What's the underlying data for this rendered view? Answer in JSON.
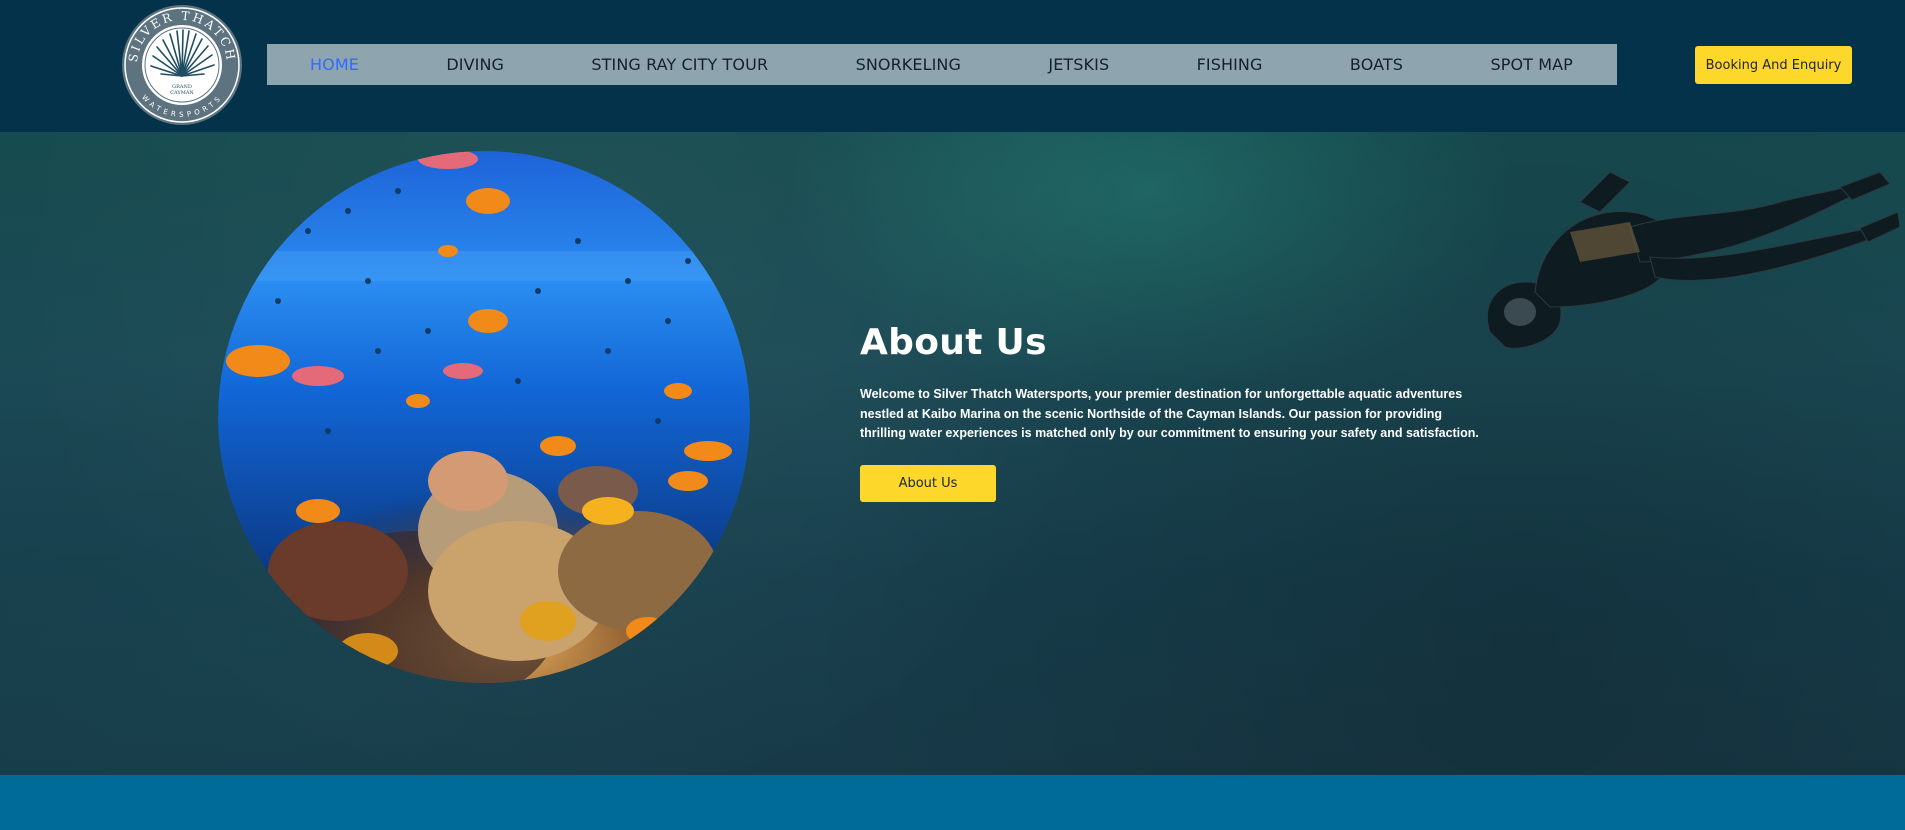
{
  "brand": {
    "logo_top_text": "SILVER THATCH",
    "logo_bottom_text": "WATERSPORTS",
    "logo_center_text": [
      "GRAND",
      "CAYMAN"
    ]
  },
  "nav": {
    "items": [
      {
        "label": "HOME",
        "active": true
      },
      {
        "label": "DIVING",
        "active": false
      },
      {
        "label": "STING RAY CITY TOUR",
        "active": false
      },
      {
        "label": "SNORKELING",
        "active": false
      },
      {
        "label": "JETSKIS",
        "active": false
      },
      {
        "label": "FISHING",
        "active": false
      },
      {
        "label": "BOATS",
        "active": false
      },
      {
        "label": "SPOT MAP",
        "active": false
      }
    ]
  },
  "header": {
    "booking_label": "Booking And Enquiry"
  },
  "hero": {
    "title": "About Us",
    "text": "Welcome to Silver Thatch Watersports, your premier destination for unforgettable aquatic adventures nestled at Kaibo Marina on the scenic Northside of the Cayman Islands. Our passion for providing thrilling water experiences is matched only by our commitment to ensuring your safety and satisfaction.",
    "button_label": "About Us"
  },
  "colors": {
    "header_bg": "#03324a",
    "nav_bg": "#8ea4ae",
    "nav_active": "#2f6bff",
    "accent_yellow": "#fdd72a",
    "bottom_band": "#006a98"
  }
}
